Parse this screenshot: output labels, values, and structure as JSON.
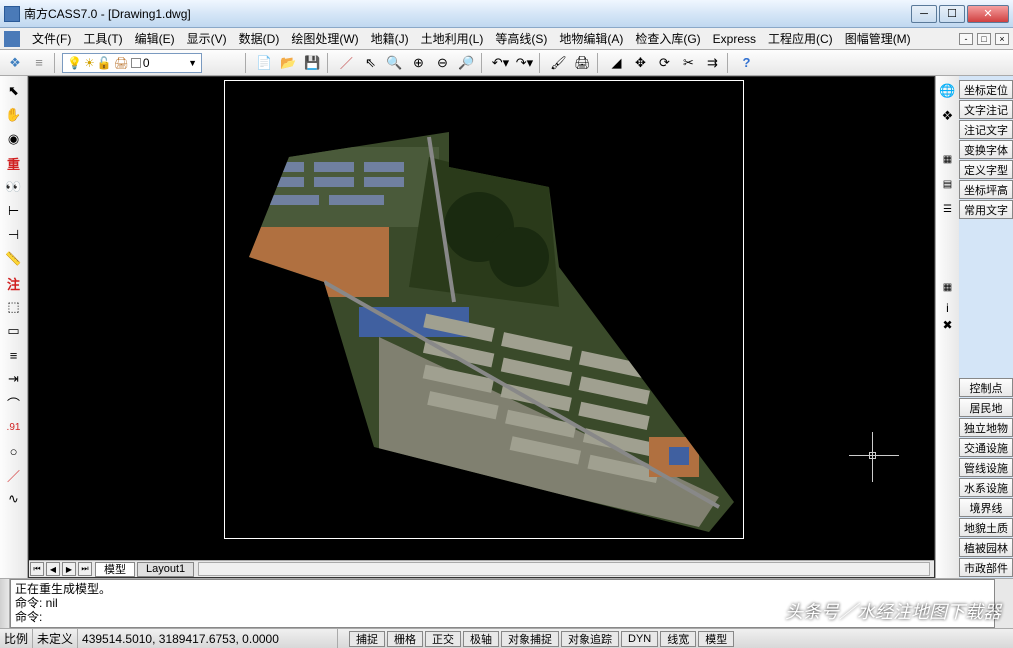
{
  "window": {
    "title": "南方CASS7.0 - [Drawing1.dwg]"
  },
  "menu": [
    "文件(F)",
    "工具(T)",
    "编辑(E)",
    "显示(V)",
    "数据(D)",
    "绘图处理(W)",
    "地籍(J)",
    "土地利用(L)",
    "等高线(S)",
    "地物编辑(A)",
    "检查入库(G)",
    "Express",
    "工程应用(C)",
    "图幅管理(M)"
  ],
  "layer": {
    "name": "0"
  },
  "tabs": {
    "model": "模型",
    "layout": "Layout1"
  },
  "command": {
    "line1": "正在重生成模型。",
    "line2": "命令:  nil",
    "line3": "命令:"
  },
  "status": {
    "scale_label": "比例",
    "scale_value": "未定义",
    "coords": "439514.5010, 3189417.6753, 0.0000",
    "buttons": [
      "捕捉",
      "栅格",
      "正交",
      "极轴",
      "对象捕捉",
      "对象追踪",
      "DYN",
      "线宽",
      "模型"
    ]
  },
  "right_panel_top": [
    "坐标定位",
    "文字注记",
    "注记文字",
    "变换字体",
    "定义字型",
    "坐标坪高",
    "常用文字"
  ],
  "right_panel_bottom": [
    "控制点",
    "居民地",
    "独立地物",
    "交通设施",
    "管线设施",
    "水系设施",
    "境界线",
    "地貌土质",
    "植被园林",
    "市政部件"
  ],
  "watermark": "头条号／水经注地图下载器"
}
